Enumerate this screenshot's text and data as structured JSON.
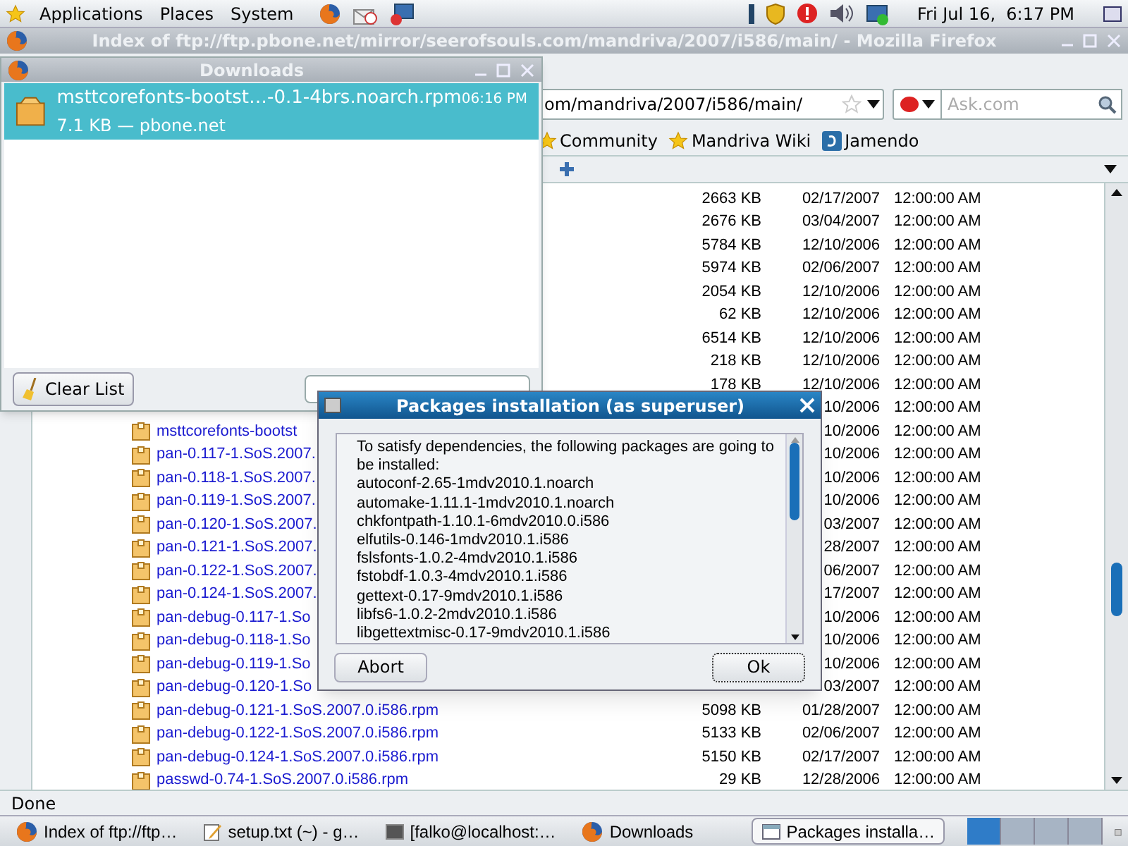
{
  "top_panel": {
    "menus": [
      "Applications",
      "Places",
      "System"
    ],
    "clock": "Fri Jul 16,  6:17 PM"
  },
  "browser": {
    "title": "Index of ftp://ftp.pbone.net/mirror/seerofsouls.com/mandriva/2007/i586/main/ - Mozilla Firefox",
    "url": "om/mandriva/2007/i586/main/",
    "search": {
      "placeholder": "Ask.com"
    },
    "bookmarks": [
      {
        "label": "Community",
        "kind": "star"
      },
      {
        "label": "Mandriva Wiki",
        "kind": "star"
      },
      {
        "label": "Jamendo",
        "kind": "site"
      }
    ],
    "files": [
      {
        "size": "2663 KB",
        "date": "02/17/2007",
        "time": "12:00:00 AM"
      },
      {
        "size": "2676 KB",
        "date": "03/04/2007",
        "time": "12:00:00 AM"
      },
      {
        "size": "5784 KB",
        "date": "12/10/2006",
        "time": "12:00:00 AM"
      },
      {
        "size": "5974 KB",
        "date": "02/06/2007",
        "time": "12:00:00 AM"
      },
      {
        "size": "2054 KB",
        "date": "12/10/2006",
        "time": "12:00:00 AM"
      },
      {
        "size": "62 KB",
        "date": "12/10/2006",
        "time": "12:00:00 AM"
      },
      {
        "size": "6514 KB",
        "date": "12/10/2006",
        "time": "12:00:00 AM"
      },
      {
        "size": "218 KB",
        "date": "12/10/2006",
        "time": "12:00:00 AM"
      },
      {
        "size": "178 KB",
        "date": "12/10/2006",
        "time": "12:00:00 AM"
      },
      {
        "date": "10/2006",
        "time": "12:00:00 AM"
      },
      {
        "name": "msttcorefonts-bootst",
        "date": "10/2006",
        "time": "12:00:00 AM"
      },
      {
        "name": "pan-0.117-1.SoS.2007.",
        "date": "10/2006",
        "time": "12:00:00 AM"
      },
      {
        "name": "pan-0.118-1.SoS.2007.",
        "date": "10/2006",
        "time": "12:00:00 AM"
      },
      {
        "name": "pan-0.119-1.SoS.2007.",
        "date": "10/2006",
        "time": "12:00:00 AM"
      },
      {
        "name": "pan-0.120-1.SoS.2007.",
        "date": "03/2007",
        "time": "12:00:00 AM"
      },
      {
        "name": "pan-0.121-1.SoS.2007.",
        "date": "28/2007",
        "time": "12:00:00 AM"
      },
      {
        "name": "pan-0.122-1.SoS.2007.",
        "date": "06/2007",
        "time": "12:00:00 AM"
      },
      {
        "name": "pan-0.124-1.SoS.2007.",
        "date": "17/2007",
        "time": "12:00:00 AM"
      },
      {
        "name": "pan-debug-0.117-1.So",
        "date": "10/2006",
        "time": "12:00:00 AM"
      },
      {
        "name": "pan-debug-0.118-1.So",
        "date": "10/2006",
        "time": "12:00:00 AM"
      },
      {
        "name": "pan-debug-0.119-1.So",
        "date": "10/2006",
        "time": "12:00:00 AM"
      },
      {
        "name": "pan-debug-0.120-1.So",
        "date": "03/2007",
        "time": "12:00:00 AM"
      },
      {
        "name": "pan-debug-0.121-1.SoS.2007.0.i586.rpm",
        "size": "5098 KB",
        "date": "01/28/2007",
        "time": "12:00:00 AM"
      },
      {
        "name": "pan-debug-0.122-1.SoS.2007.0.i586.rpm",
        "size": "5133 KB",
        "date": "02/06/2007",
        "time": "12:00:00 AM"
      },
      {
        "name": "pan-debug-0.124-1.SoS.2007.0.i586.rpm",
        "size": "5150 KB",
        "date": "02/17/2007",
        "time": "12:00:00 AM"
      },
      {
        "name": "passwd-0.74-1.SoS.2007.0.i586.rpm",
        "size": "29 KB",
        "date": "12/28/2006",
        "time": "12:00:00 AM"
      }
    ],
    "status": "Done"
  },
  "downloads": {
    "title": "Downloads",
    "items": [
      {
        "name": "msttcorefonts-bootst…-0.1-4brs.noarch.rpm",
        "time": "06:16 PM",
        "info": "7.1 KB — pbone.net",
        "selected": true
      }
    ],
    "clear_button": "Clear List"
  },
  "dialog": {
    "title": "Packages installation (as superuser)",
    "message": "To satisfy dependencies, the following packages are going to be installed:",
    "packages": [
      "autoconf-2.65-1mdv2010.1.noarch",
      "automake-1.11.1-1mdv2010.1.noarch",
      "chkfontpath-1.10.1-6mdv2010.0.i586",
      "elfutils-0.146-1mdv2010.1.i586",
      "fslsfonts-1.0.2-4mdv2010.1.i586",
      "fstobdf-1.0.3-4mdv2010.1.i586",
      "gettext-0.17-9mdv2010.1.i586",
      "libfs6-1.0.2-2mdv2010.1.i586",
      "libgettextmisc-0.17-9mdv2010.1.i586"
    ],
    "buttons": [
      {
        "label": "Abort",
        "focused": false
      },
      {
        "label": "Ok",
        "focused": true
      }
    ]
  },
  "taskbar": {
    "items": [
      {
        "label": "Index of ftp://ftp…",
        "kind": "browser",
        "selected": false
      },
      {
        "label": "setup.txt (~) - g…",
        "kind": "editor",
        "selected": false
      },
      {
        "label": "[falko@localhost:…",
        "kind": "terminal",
        "selected": false
      },
      {
        "label": "Downloads",
        "kind": "browser",
        "selected": false
      },
      {
        "label": "Packages installa…",
        "kind": "window",
        "selected": true
      }
    ],
    "workspaces": [
      {
        "selected": true
      },
      {
        "selected": false
      },
      {
        "selected": false
      },
      {
        "selected": false
      }
    ]
  }
}
